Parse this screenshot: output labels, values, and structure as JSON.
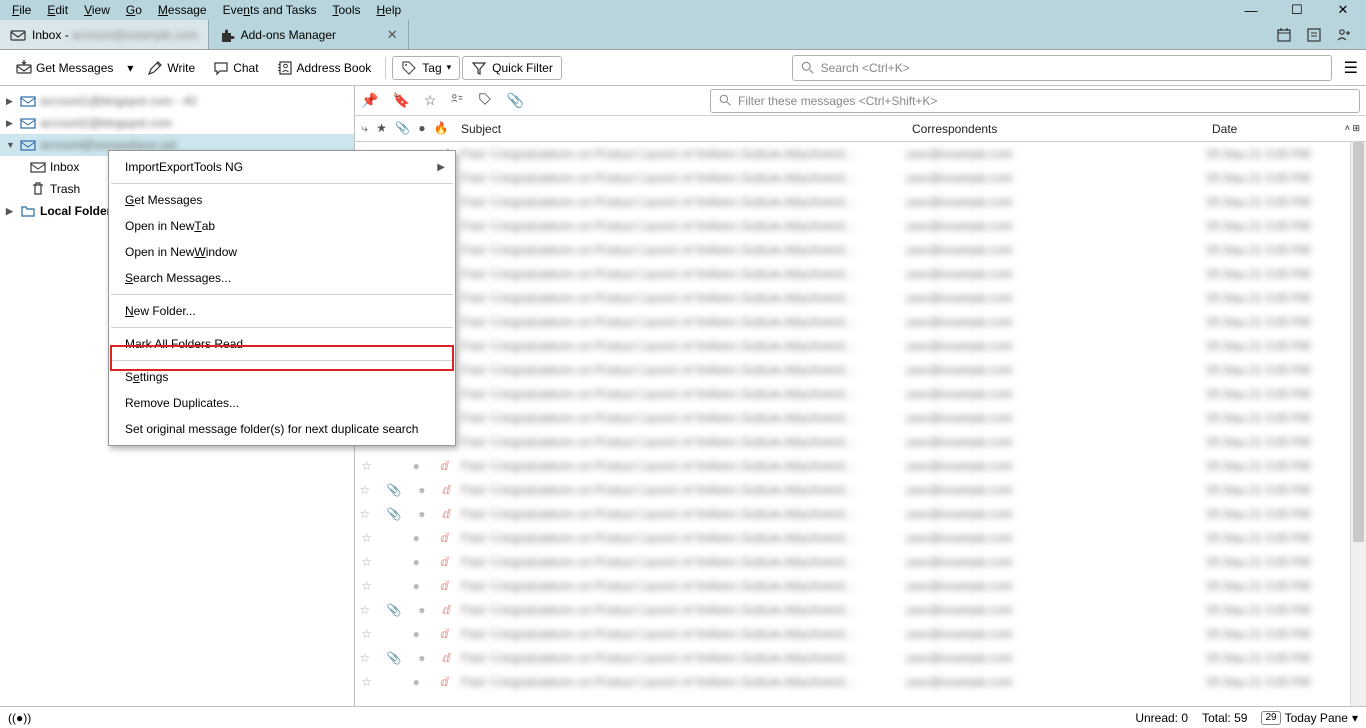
{
  "menu": [
    "File",
    "Edit",
    "View",
    "Go",
    "Message",
    "Events and Tasks",
    "Tools",
    "Help"
  ],
  "tabs": [
    {
      "icon": "inbox",
      "label": "Inbox - ",
      "blurred_suffix": "account@example.com",
      "active": true,
      "closable": false
    },
    {
      "icon": "addon",
      "label": "Add-ons Manager",
      "active": false,
      "closable": true
    }
  ],
  "toolbar": {
    "get_messages": "Get Messages",
    "write": "Write",
    "chat": "Chat",
    "address_book": "Address Book",
    "tag": "Tag",
    "quick_filter": "Quick Filter",
    "search_placeholder": "Search <Ctrl+K>"
  },
  "sidebar": {
    "accounts": [
      {
        "blur": "account1@blogspot.com - 40",
        "expand": ">"
      },
      {
        "blur": "account2@blogspot.com",
        "expand": ">"
      },
      {
        "blur": "account@somewhere.net",
        "expand": "v",
        "selected": true
      }
    ],
    "inbox": "Inbox",
    "trash": "Trash",
    "local_folders": "Local Folders"
  },
  "filterbar": {
    "placeholder": "Filter these messages <Ctrl+Shift+K>"
  },
  "columns": {
    "subject": "Subject",
    "correspondents": "Correspondents",
    "date": "Date"
  },
  "messages_count": 23,
  "context_menu": {
    "items": [
      {
        "label": "ImportExportTools NG",
        "submenu": true
      },
      {
        "sep": true
      },
      {
        "label": "Get Messages",
        "u": 0
      },
      {
        "label": "Open in New Tab",
        "u": 12
      },
      {
        "label": "Open in New Window",
        "u": 12
      },
      {
        "label": "Search Messages...",
        "u": 0
      },
      {
        "sep": true
      },
      {
        "label": "New Folder...",
        "u": 0
      },
      {
        "sep": true
      },
      {
        "label": "Mark All Folders Read"
      },
      {
        "sep": true
      },
      {
        "label": "Settings",
        "u": 1
      },
      {
        "label": "Remove Duplicates...",
        "highlight": true
      },
      {
        "label": "Set original message folder(s) for next duplicate search"
      }
    ]
  },
  "statusbar": {
    "unread_label": "Unread:",
    "unread": "0",
    "total_label": "Total:",
    "total": "59",
    "today_pane": "Today Pane",
    "today_badge": "29"
  }
}
